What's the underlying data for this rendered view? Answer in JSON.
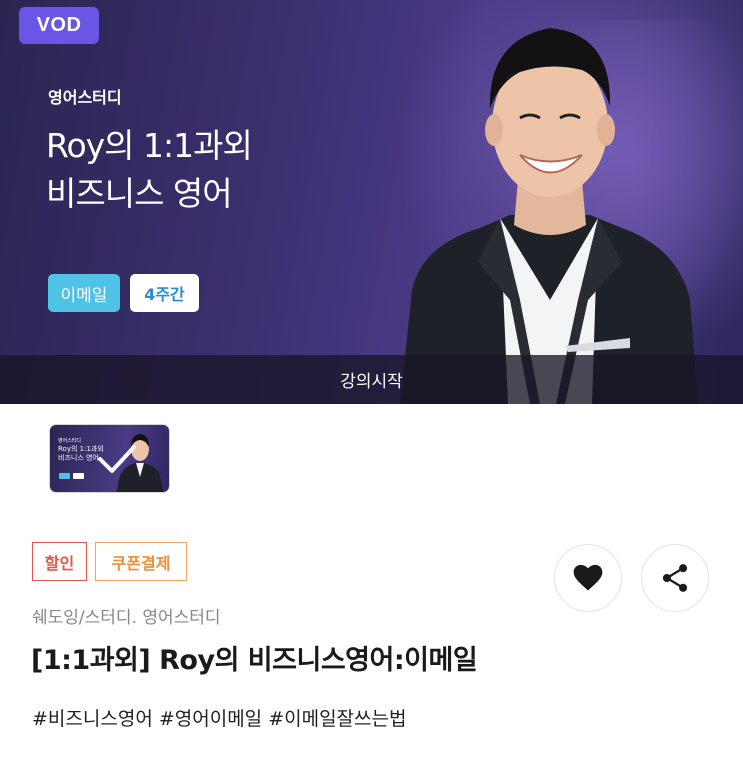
{
  "hero": {
    "badge": "VOD",
    "category": "영어스터디",
    "title_line1": "Roy의 1:1과외",
    "title_line2": "비즈니스 영어",
    "tag_email": "이메일",
    "tag_weeks": "4주간",
    "start_label": "강의시작"
  },
  "thumbnail": {
    "category": "영어스터디",
    "title_line1": "Roy의 1:1과외",
    "title_line2": "비즈니스 영어"
  },
  "product": {
    "badges": [
      "할인",
      "쿠폰결제"
    ],
    "breadcrumb": "쉐도잉/스터디. 영어스터디",
    "title": "[1:1과외] Roy의 비즈니스영어:이메일",
    "hashtags": "#비즈니스영어 #영어이메일 #이메일잘쓰는법"
  },
  "icons": {
    "like": "heart-icon",
    "share": "share-icon",
    "selected": "checkmark-icon"
  },
  "colors": {
    "vod_badge": "#6a56e6",
    "email_tag": "#4fc3e6",
    "weeks_text": "#2a8ec9",
    "sale_badge": "#e2574c",
    "coupon_badge": "#ee8f3a"
  }
}
